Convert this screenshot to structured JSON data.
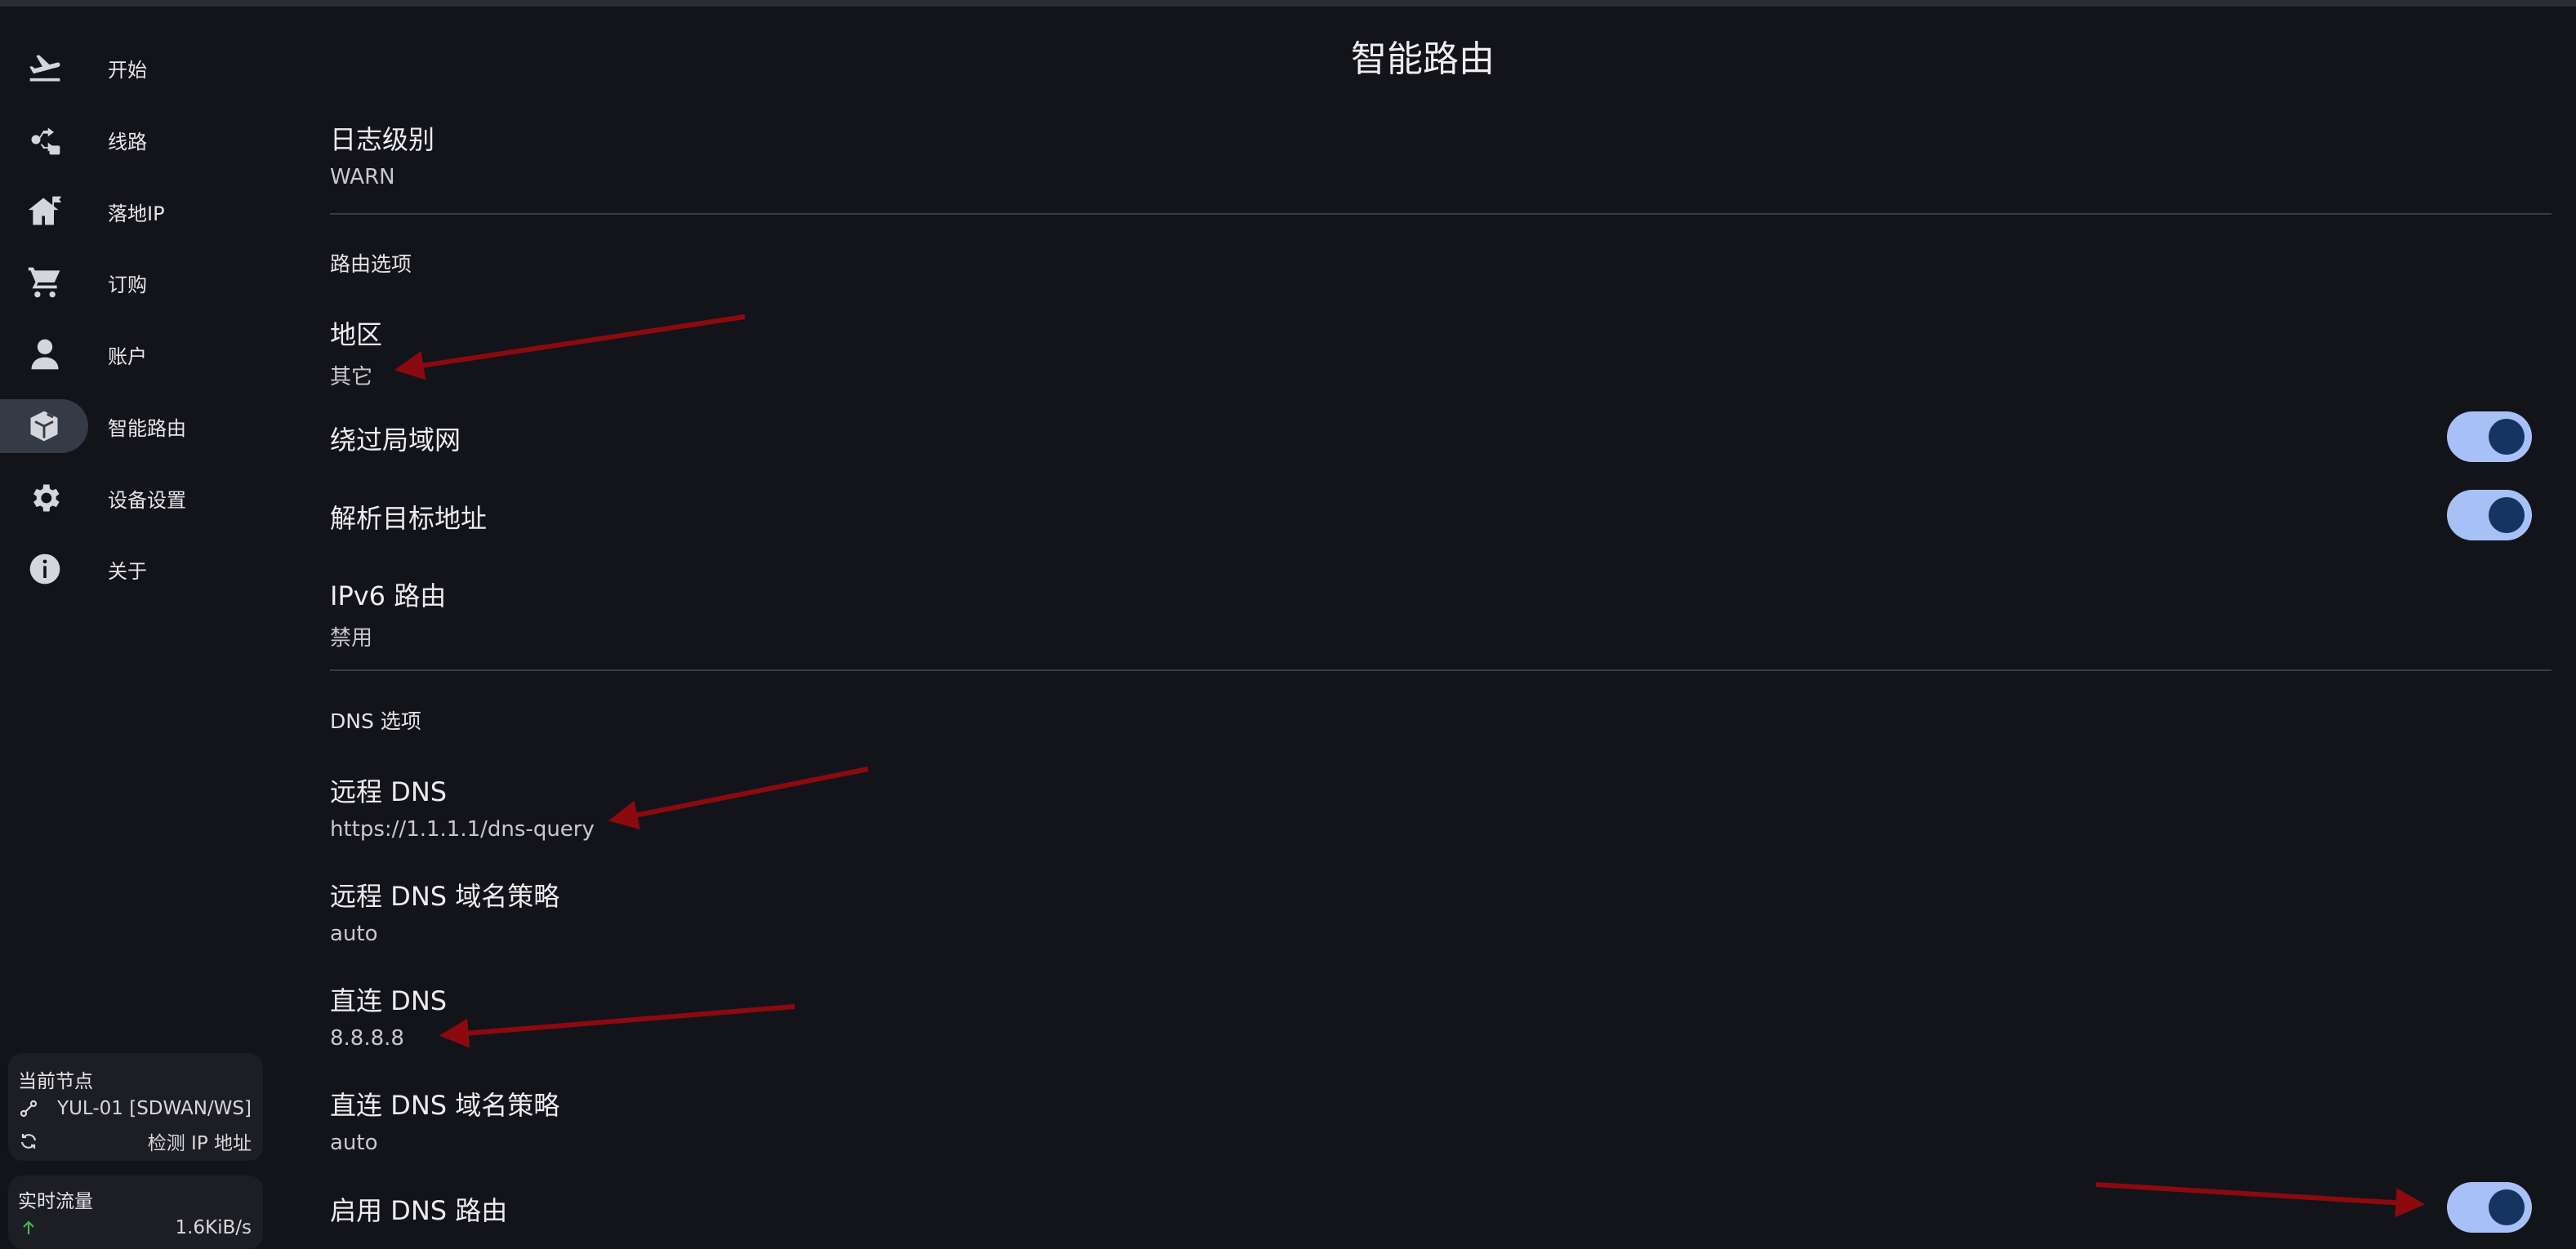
{
  "page_title": "智能路由",
  "sidebar": {
    "items": [
      {
        "label": "开始",
        "icon": "airplane-icon"
      },
      {
        "label": "线路",
        "icon": "route-icon"
      },
      {
        "label": "落地IP",
        "icon": "house-flag-icon"
      },
      {
        "label": "订购",
        "icon": "cart-icon"
      },
      {
        "label": "账户",
        "icon": "person-icon"
      },
      {
        "label": "智能路由",
        "icon": "route-box-icon",
        "active": true
      },
      {
        "label": "设备设置",
        "icon": "gear-icon"
      },
      {
        "label": "关于",
        "icon": "info-icon"
      }
    ],
    "current_node": {
      "title": "当前节点",
      "node": "YUL-01 [SDWAN/WS]",
      "detect_ip": "检测 IP 地址"
    },
    "traffic": {
      "title": "实时流量",
      "upload": "1.6KiB/s"
    }
  },
  "settings": {
    "log_level": {
      "title": "日志级别",
      "value": "WARN"
    },
    "routing_section": "路由选项",
    "region": {
      "title": "地区",
      "value": "其它"
    },
    "bypass_lan": {
      "title": "绕过局域网",
      "enabled": true
    },
    "resolve_dest": {
      "title": "解析目标地址",
      "enabled": true
    },
    "ipv6_route": {
      "title": "IPv6 路由",
      "value": "禁用"
    },
    "dns_section": "DNS 选项",
    "remote_dns": {
      "title": "远程 DNS",
      "value": "https://1.1.1.1/dns-query"
    },
    "remote_dns_strategy": {
      "title": "远程 DNS 域名策略",
      "value": "auto"
    },
    "direct_dns": {
      "title": "直连 DNS",
      "value": "8.8.8.8"
    },
    "direct_dns_strategy": {
      "title": "直连 DNS 域名策略",
      "value": "auto"
    },
    "enable_dns_route": {
      "title": "启用 DNS 路由",
      "enabled": true
    }
  },
  "colors": {
    "background": "#131419",
    "toggle_track": "#a7c1f7",
    "toggle_knob": "#163462",
    "annotation_arrow": "#8b0a0f",
    "upload_arrow": "#3fb950"
  }
}
